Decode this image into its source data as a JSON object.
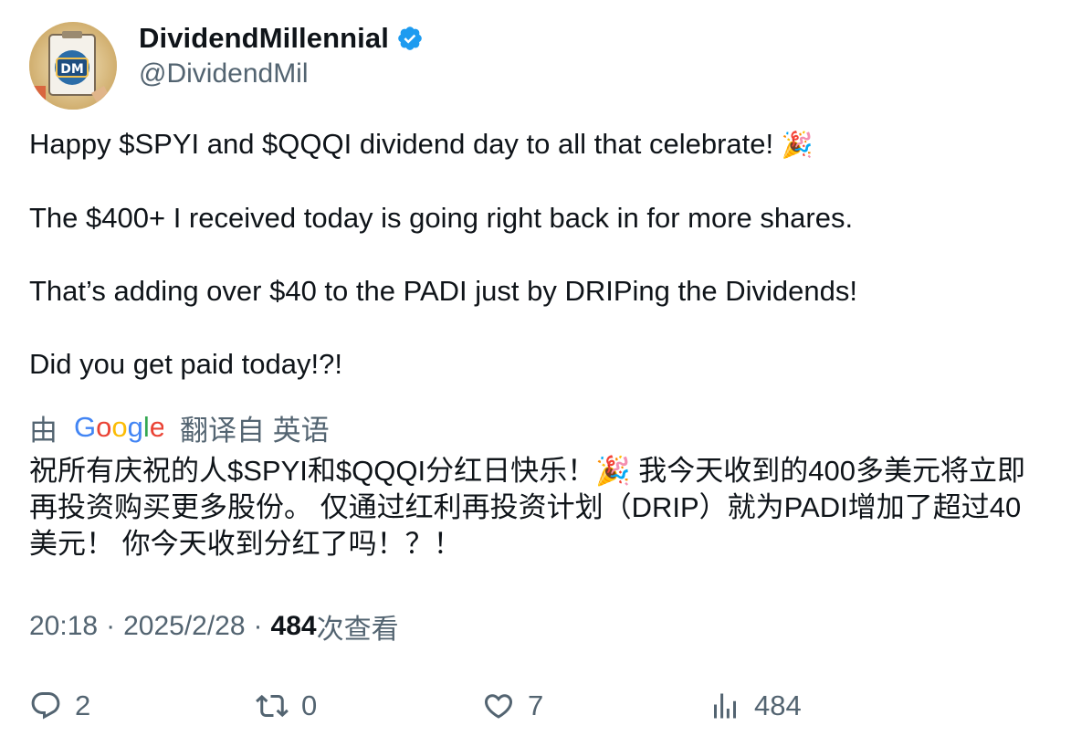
{
  "author": {
    "name": "DividendMillennial",
    "handle": "@DividendMil",
    "verified": true,
    "avatar_text": "DM",
    "verified_color": "#1d9bf0"
  },
  "tweet": {
    "paragraphs": [
      {
        "text": "Happy $SPYI and $QQQI dividend day to all that celebrate! ",
        "emoji": "🎉"
      },
      {
        "text": "The $400+ I received today is going right back in for more shares."
      },
      {
        "text": "That’s adding over $40 to the PADI just by DRIPing the Dividends!"
      },
      {
        "text": "Did you get paid today!?!"
      }
    ]
  },
  "translation": {
    "prefix": "由",
    "logo_text": "Google",
    "suffix": "翻译自 英语",
    "lines": [
      "祝所有庆祝的人$SPYI和$QQQI分红日快乐！🎉 我今天收到的400多美元将立即",
      "再投资购买更多股份。 仅通过红利再投资计划（DRIP）就为PADI增加了超过40",
      "美元！ 你今天收到分红了吗！？！"
    ]
  },
  "meta": {
    "time": "20:18",
    "separator": "·",
    "date": "2025/2/28",
    "views_count": "484",
    "views_label": "次查看"
  },
  "actions": {
    "replies": "2",
    "reposts": "0",
    "likes": "7",
    "views": "484"
  },
  "colors": {
    "text": "#0f1419",
    "secondary": "#536471",
    "google_blue": "#4285F4",
    "google_red": "#EA4335",
    "google_yellow": "#FBBC05",
    "google_green": "#34A853"
  }
}
